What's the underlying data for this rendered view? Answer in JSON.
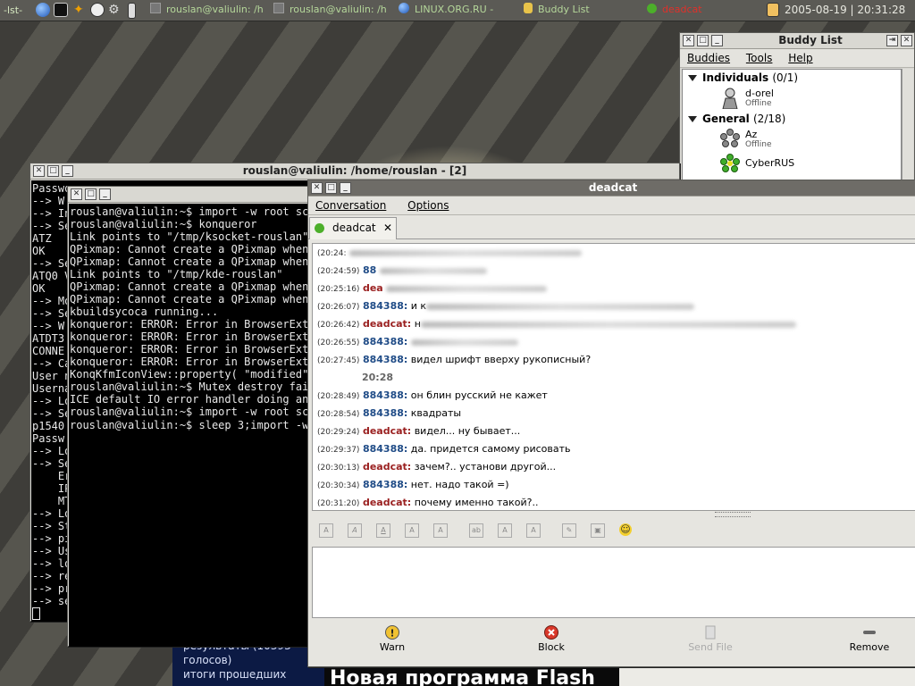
{
  "panel": {
    "menu_label": "-lst-",
    "tasks": [
      "rouslan@valiulin: /h",
      "rouslan@valiulin: /h",
      "LINUX.ORG.RU -",
      "Buddy List",
      "deadcat"
    ],
    "clock": "2005-08-19 | 20:31:28"
  },
  "colors": {
    "panel_text": "#d6e8c0",
    "task_text": "#b5d79a",
    "deadcat_task": "#e0302a",
    "incoming_name": "#9a2020",
    "outgoing_name": "#204c87"
  },
  "buddy_list": {
    "title": "Buddy List",
    "menu": [
      "Buddies",
      "Tools",
      "Help"
    ],
    "groups": [
      {
        "name": "Individuals",
        "count": "(0/1)",
        "buddies": [
          {
            "name": "d-orel",
            "status": "Offline",
            "icon": "person-icon"
          }
        ]
      },
      {
        "name": "General",
        "count": "(2/18)",
        "buddies": [
          {
            "name": "Az",
            "status": "Offline",
            "icon": "icq-flower-icon"
          },
          {
            "name": "CyberRUS",
            "status": "",
            "icon": "icq-flower-icon"
          }
        ]
      }
    ]
  },
  "terminal_back": {
    "title": "rouslan@valiulin: /home/rouslan - [2]",
    "lines": [
      "Passwo",
      "--> W",
      "--> In",
      "--> Se",
      "ATZ",
      "OK",
      "--> Se",
      "ATQ0 V",
      "OK",
      "--> Mo",
      "--> Se",
      "--> W",
      "ATDT3",
      "CONNE",
      "--> Ca",
      "User n",
      "Userna",
      "--> Lo",
      "--> Se",
      "p1540",
      "Passw",
      "--> Lo",
      "--> Se",
      "    Er",
      "    IP",
      "    MT",
      "--> Lo",
      "--> St",
      "--> pi",
      "--> Us",
      "--> lo",
      "--> re",
      "--> pr",
      "--> se",
      ""
    ]
  },
  "terminal_front": {
    "lines": [
      "rouslan@valiulin:~$ import -w root scr",
      "rouslan@valiulin:~$ konqueror",
      "Link points to \"/tmp/ksocket-rouslan\"",
      "QPixmap: Cannot create a QPixmap when",
      "QPixmap: Cannot create a QPixmap when",
      "Link points to \"/tmp/kde-rouslan\"",
      "QPixmap: Cannot create a QPixmap when",
      "QPixmap: Cannot create a QPixmap when",
      "kbuildsycoca running...",
      "konqueror: ERROR: Error in BrowserExte",
      "konqueror: ERROR: Error in BrowserExte",
      "konqueror: ERROR: Error in BrowserExte",
      "konqueror: ERROR: Error in BrowserExte",
      "KonqKfmIconView::property( \"modified\"",
      "rouslan@valiulin:~$ Mutex destroy fail",
      "ICE default IO error handler doing an",
      "",
      "rouslan@valiulin:~$ import -w root scr",
      "rouslan@valiulin:~$ sleep 3;import -w"
    ]
  },
  "chat": {
    "title": "deadcat",
    "menu": [
      "Conversation",
      "Options"
    ],
    "tab_label": "deadcat",
    "messages": [
      {
        "time": "(20:24:",
        "name": "",
        "text": "",
        "blur": 260,
        "color": "r"
      },
      {
        "time": "(20:24:59)",
        "name": "88",
        "text": "",
        "blur": 120,
        "color": "b"
      },
      {
        "time": "(20:25:16)",
        "name": "dea",
        "text": "",
        "blur": 180,
        "color": "r"
      },
      {
        "time": "(20:26:07)",
        "name": "884388:",
        "text": "и к",
        "blur": 300,
        "color": "b"
      },
      {
        "time": "(20:26:42)",
        "name": "deadcat:",
        "text": "н",
        "blur": 420,
        "color": "r"
      },
      {
        "time": "(20:26:55)",
        "name": "884388:",
        "text": "",
        "blur": 120,
        "color": "b"
      },
      {
        "time": "(20:27:45)",
        "name": "884388:",
        "text": "видел шрифт вверху рукописный?",
        "blur": 0,
        "color": "b"
      },
      {
        "time": "",
        "name": "",
        "text": "20:28",
        "blur": 0,
        "color": "sep"
      },
      {
        "time": "(20:28:49)",
        "name": "884388:",
        "text": "он блин русский не кажет",
        "blur": 0,
        "color": "b"
      },
      {
        "time": "(20:28:54)",
        "name": "884388:",
        "text": "квадраты",
        "blur": 0,
        "color": "b"
      },
      {
        "time": "(20:29:24)",
        "name": "deadcat:",
        "text": "видел... ну бывает...",
        "blur": 0,
        "color": "r"
      },
      {
        "time": "(20:29:37)",
        "name": "884388:",
        "text": "да. придется самому рисовать",
        "blur": 0,
        "color": "b"
      },
      {
        "time": "(20:30:13)",
        "name": "deadcat:",
        "text": "зачем?.. установи другой...",
        "blur": 0,
        "color": "r"
      },
      {
        "time": "(20:30:34)",
        "name": "884388:",
        "text": "нет. надо такой =)",
        "blur": 0,
        "color": "b"
      },
      {
        "time": "(20:31:20)",
        "name": "deadcat:",
        "text": "почему именно такой?..",
        "blur": 0,
        "color": "r"
      }
    ],
    "format_tools": [
      "bold-icon",
      "italic-icon",
      "underline-icon",
      "font-larger-icon",
      "font-smaller-icon",
      "font-face-icon",
      "text-color-icon",
      "background-color-icon",
      "link-icon",
      "image-icon",
      "smiley-icon"
    ],
    "input_value": "",
    "actions": [
      {
        "label": "Warn",
        "icon": "warning-icon",
        "enabled": true
      },
      {
        "label": "Block",
        "icon": "block-icon",
        "enabled": true
      },
      {
        "label": "Send File",
        "icon": "send-file-icon",
        "enabled": false
      },
      {
        "label": "Remove",
        "icon": "remove-icon",
        "enabled": true
      }
    ]
  },
  "background_page": {
    "lines": [
      "результаты (10393",
      "голосов)",
      "итоги прошедших"
    ],
    "headline": "Новая программа Flash"
  }
}
